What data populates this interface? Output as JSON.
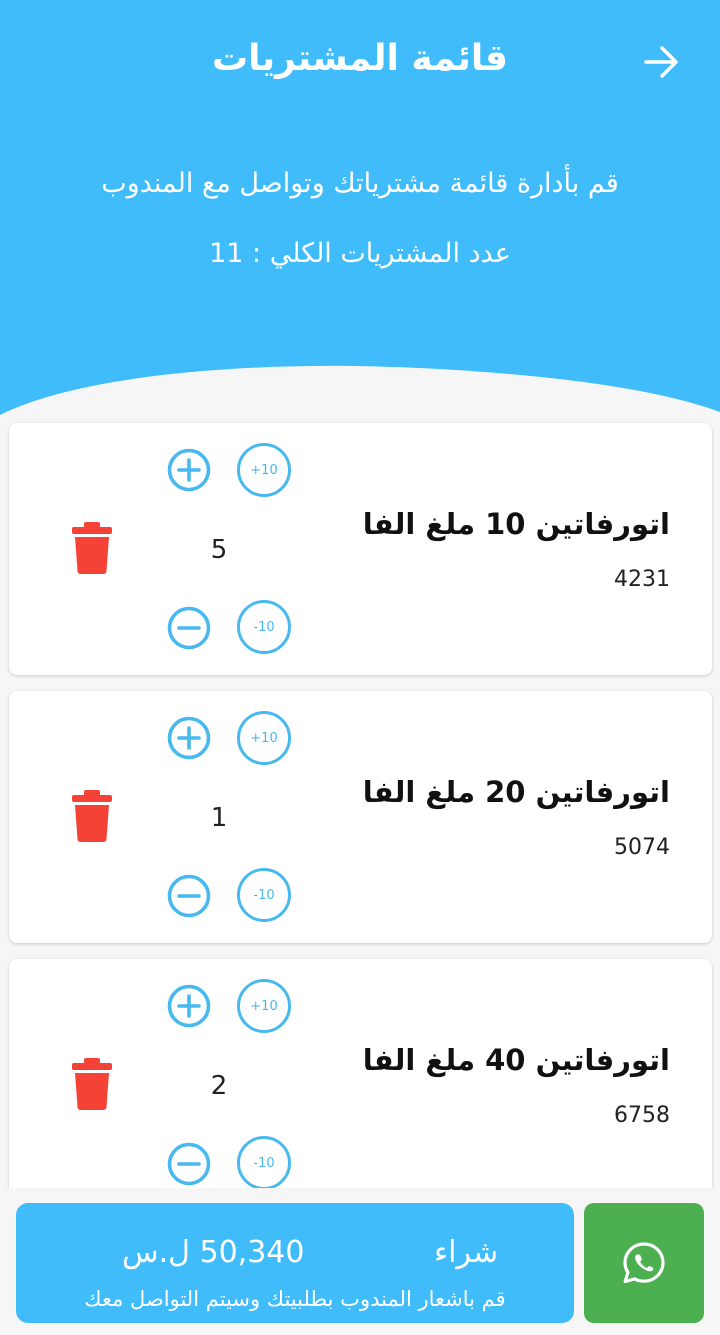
{
  "header": {
    "title": "قائمة المشتريات",
    "subtitle": "قم بأدارة قائمة مشترياتك وتواصل مع المندوب",
    "total_label": "عدد المشتريات الكلي  :",
    "total_count": "11"
  },
  "items": [
    {
      "name": "اتورفاتين 10 ملغ الفا",
      "code": "4231",
      "quantity": "5",
      "plus10": "+10",
      "minus10": "-10"
    },
    {
      "name": "اتورفاتين 20 ملغ الفا",
      "code": "5074",
      "quantity": "1",
      "plus10": "+10",
      "minus10": "-10"
    },
    {
      "name": "اتورفاتين 40 ملغ الفا",
      "code": "6758",
      "quantity": "2",
      "plus10": "+10",
      "minus10": "-10"
    }
  ],
  "footer": {
    "buy_label": "شراء",
    "price": "50,340 ل.س",
    "note": "قم باشعار المندوب بطلبيتك وسيتم التواصل معك"
  },
  "colors": {
    "primary": "#40bcfb",
    "accent_outline": "#47b9ef",
    "delete": "#f44336",
    "whatsapp": "#4caf50"
  },
  "icons": {
    "back": "arrow-right-icon",
    "delete": "trash-icon",
    "increment": "plus-circle-icon",
    "decrement": "minus-circle-icon",
    "chat": "whatsapp-icon"
  }
}
